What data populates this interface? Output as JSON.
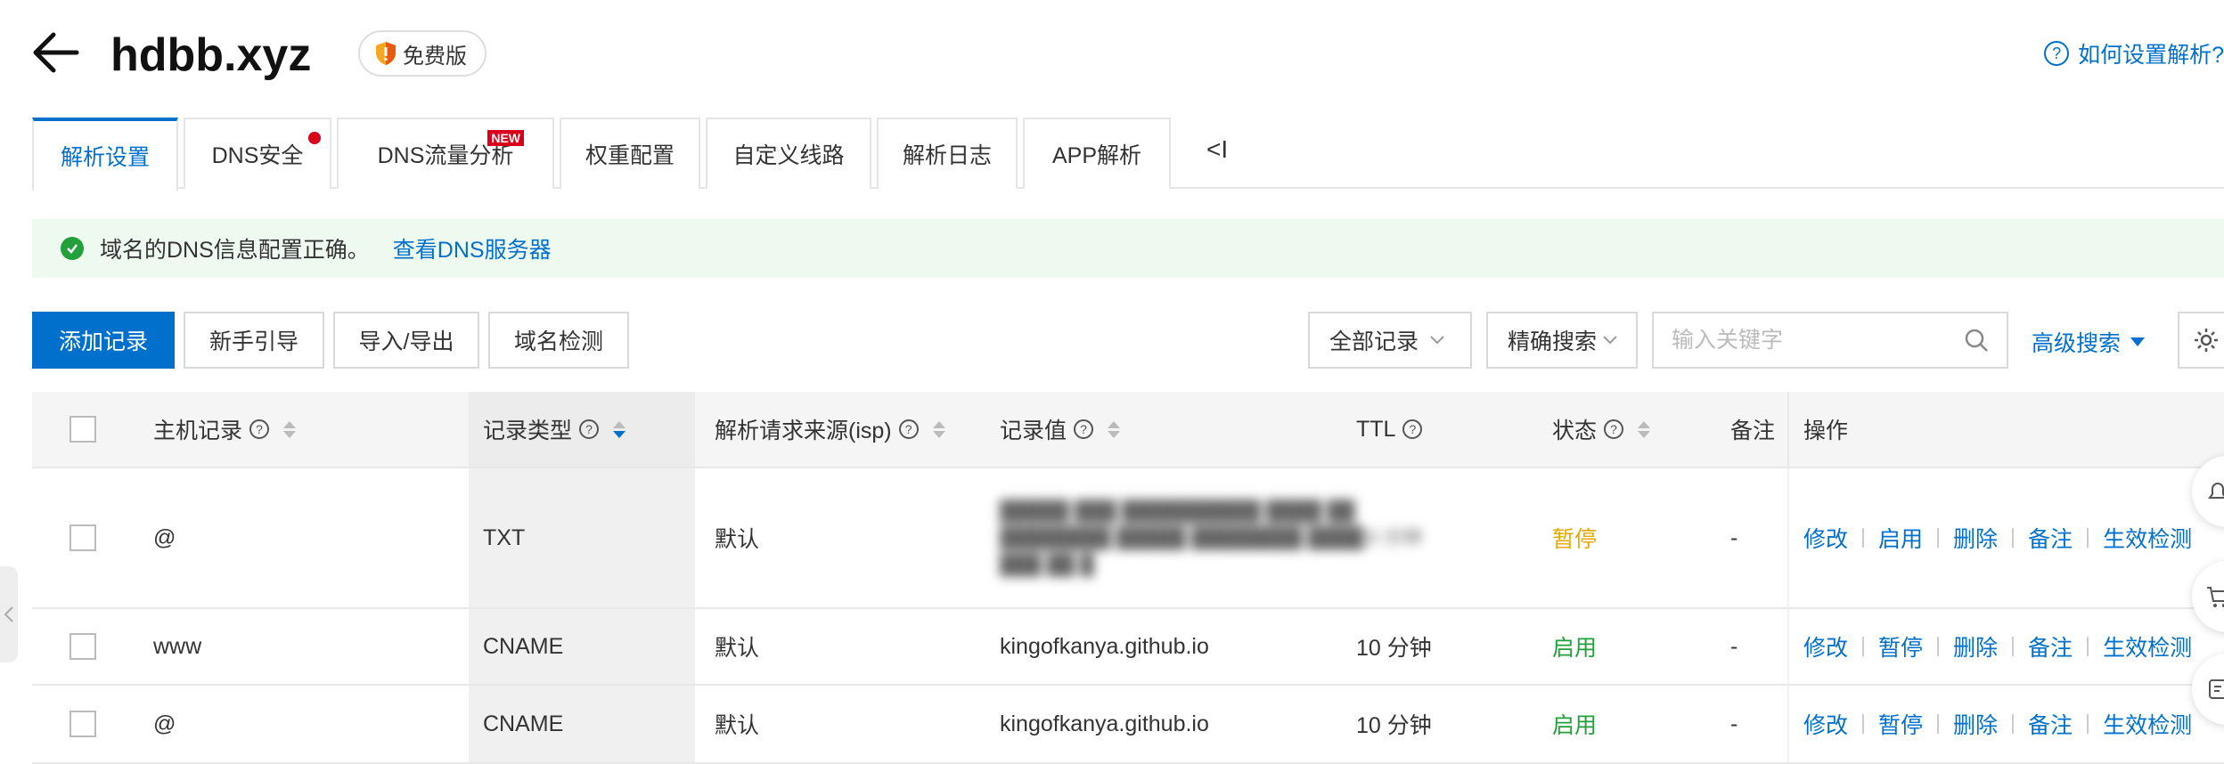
{
  "header": {
    "domain": "hdbb.xyz",
    "edition_badge": "免费版",
    "help_link": "如何设置解析?"
  },
  "tabs": [
    {
      "label": "解析设置",
      "active": true
    },
    {
      "label": "DNS安全",
      "dot": true
    },
    {
      "label": "DNS流量分析",
      "badge": "NEW"
    },
    {
      "label": "权重配置"
    },
    {
      "label": "自定义线路"
    },
    {
      "label": "解析日志"
    },
    {
      "label": "APP解析"
    }
  ],
  "tab_collapse": "<I",
  "alert": {
    "message": "域名的DNS信息配置正确。",
    "link": "查看DNS服务器"
  },
  "toolbar": {
    "add_record": "添加记录",
    "guide": "新手引导",
    "import_export": "导入/导出",
    "domain_check": "域名检测",
    "record_filter": "全部记录",
    "search_mode": "精确搜索",
    "search_placeholder": "输入关键字",
    "advanced_search": "高级搜索"
  },
  "table": {
    "columns": {
      "host": "主机记录",
      "type": "记录类型",
      "isp": "解析请求来源(isp)",
      "value": "记录值",
      "ttl": "TTL",
      "status": "状态",
      "remark": "备注",
      "actions": "操作"
    },
    "rows": [
      {
        "host": "@",
        "type": "TXT",
        "isp": "默认",
        "value": "",
        "ttl": "10 分钟",
        "status": "暂停",
        "remark": "-",
        "toggle_action": "启用"
      },
      {
        "host": "www",
        "type": "CNAME",
        "isp": "默认",
        "value": "kingofkanya.github.io",
        "ttl": "10 分钟",
        "status": "启用",
        "remark": "-",
        "toggle_action": "暂停"
      },
      {
        "host": "@",
        "type": "CNAME",
        "isp": "默认",
        "value": "kingofkanya.github.io",
        "ttl": "10 分钟",
        "status": "启用",
        "remark": "-",
        "toggle_action": "暂停"
      }
    ],
    "action_labels": {
      "edit": "修改",
      "delete": "删除",
      "remark": "备注",
      "verify": "生效检测"
    }
  },
  "colors": {
    "accent": "#0070cc",
    "paused": "#e6a800",
    "enabled": "#23a03c",
    "danger_dot": "#d9001b",
    "alert_bg": "#eefaf0"
  },
  "icons": [
    "back-arrow-icon",
    "shield-icon",
    "help-circle-icon",
    "check-circle-icon",
    "search-icon",
    "caret-down-icon",
    "gear-icon",
    "sort-icon",
    "question-icon"
  ]
}
